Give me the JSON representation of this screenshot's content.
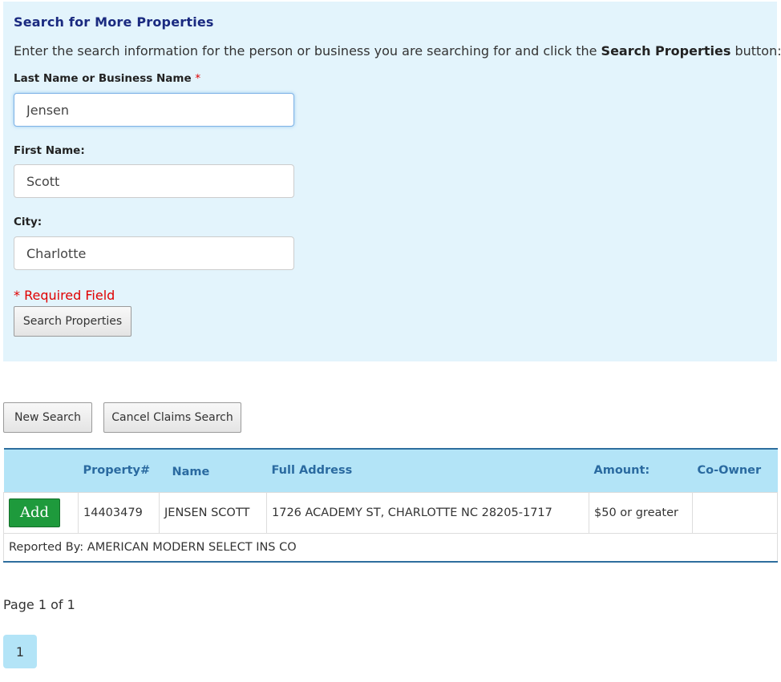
{
  "search_panel": {
    "title": "Search for More Properties",
    "instructions_pre": "Enter the search information for the person or business you are searching for and click the ",
    "instructions_bold": "Search Properties",
    "instructions_post": " button:",
    "last_name_label": "Last Name or Business Name",
    "required_star": "*",
    "last_name_value": "Jensen",
    "first_name_label": "First Name:",
    "first_name_value": "Scott",
    "city_label": "City:",
    "city_value": "Charlotte",
    "required_note": "* Required Field",
    "search_button": "Search Properties"
  },
  "actions": {
    "new_search": "New Search",
    "cancel_claims_search": "Cancel Claims Search"
  },
  "results": {
    "headers": [
      "",
      "Property#",
      "Name",
      "Full Address",
      "Amount:",
      "Co-Owner"
    ],
    "rows": [
      {
        "add_label": "Add",
        "property_no": "14403479",
        "name": "JENSEN SCOTT",
        "address": "1726 ACADEMY ST, CHARLOTTE NC 28205-1717",
        "amount": "$50 or greater",
        "co_owner": "",
        "reported_by": "Reported By: AMERICAN MODERN SELECT INS CO"
      }
    ]
  },
  "pagination": {
    "info": "Page 1 of 1",
    "pages": [
      "1"
    ]
  },
  "colors": {
    "panel_bg": "#e3f4fc",
    "title": "#1a2a80",
    "header_bg": "#b3e4f7",
    "header_text": "#2a6aa0",
    "add_button": "#1e9a3c",
    "required": "#e00000"
  }
}
